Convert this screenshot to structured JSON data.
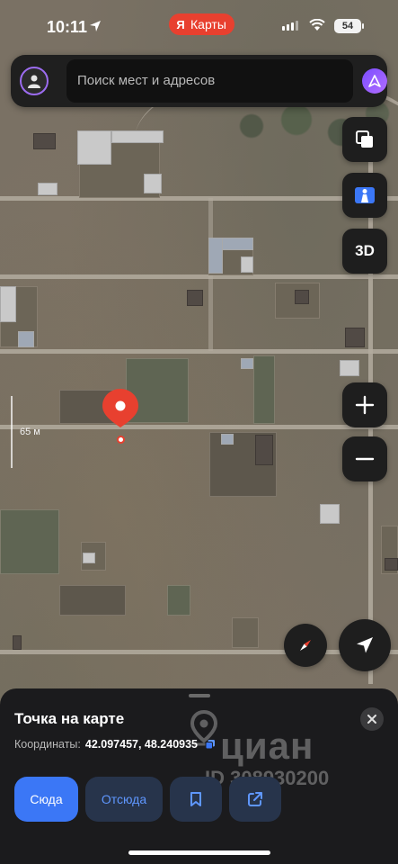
{
  "status_bar": {
    "time": "10:11",
    "app_badge": "Карты",
    "brand_letter": "Я",
    "battery": "54"
  },
  "search": {
    "placeholder": "Поиск мест и адресов"
  },
  "map": {
    "scale_label": "65 м"
  },
  "controls": {
    "three_d_label": "3D"
  },
  "sheet": {
    "title": "Точка на карте",
    "coords_label": "Координаты:",
    "coords_value": "42.097457, 48.240935",
    "btn_here": "Сюда",
    "btn_from": "Отсюда"
  },
  "watermark": {
    "brand": "циан",
    "id": "ID 308930200"
  },
  "colors": {
    "accent_red": "#e8402f",
    "primary_blue": "#3b77f6",
    "sheet_bg": "#1b1b1d",
    "alice_purple": "#8b57ff"
  }
}
